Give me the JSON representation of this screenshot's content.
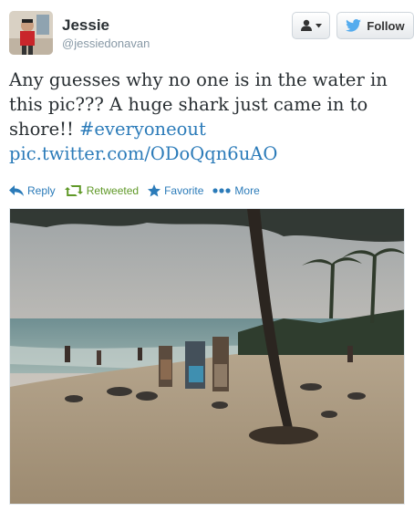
{
  "user": {
    "name": "Jessie",
    "handle": "@jessiedonavan"
  },
  "buttons": {
    "follow_label": "Follow"
  },
  "tweet": {
    "text_part1": "Any guesses why no one is in the water in this pic??? A huge shark just came in to shore!! ",
    "hashtag": "#everyoneout",
    "link": "pic.twitter.com/ODoQqn6uAO"
  },
  "actions": {
    "reply": "Reply",
    "retweeted": "Retweeted",
    "favorite": "Favorite",
    "more": "More"
  },
  "colors": {
    "link": "#2b7bb9",
    "retweeted": "#609928",
    "twitter_bird": "#55acee"
  },
  "icons": {
    "dropdown": "user-icon",
    "follow": "twitter-bird-icon",
    "reply": "reply-icon",
    "retweet": "retweet-icon",
    "favorite": "star-icon",
    "more": "more-dots-icon"
  }
}
